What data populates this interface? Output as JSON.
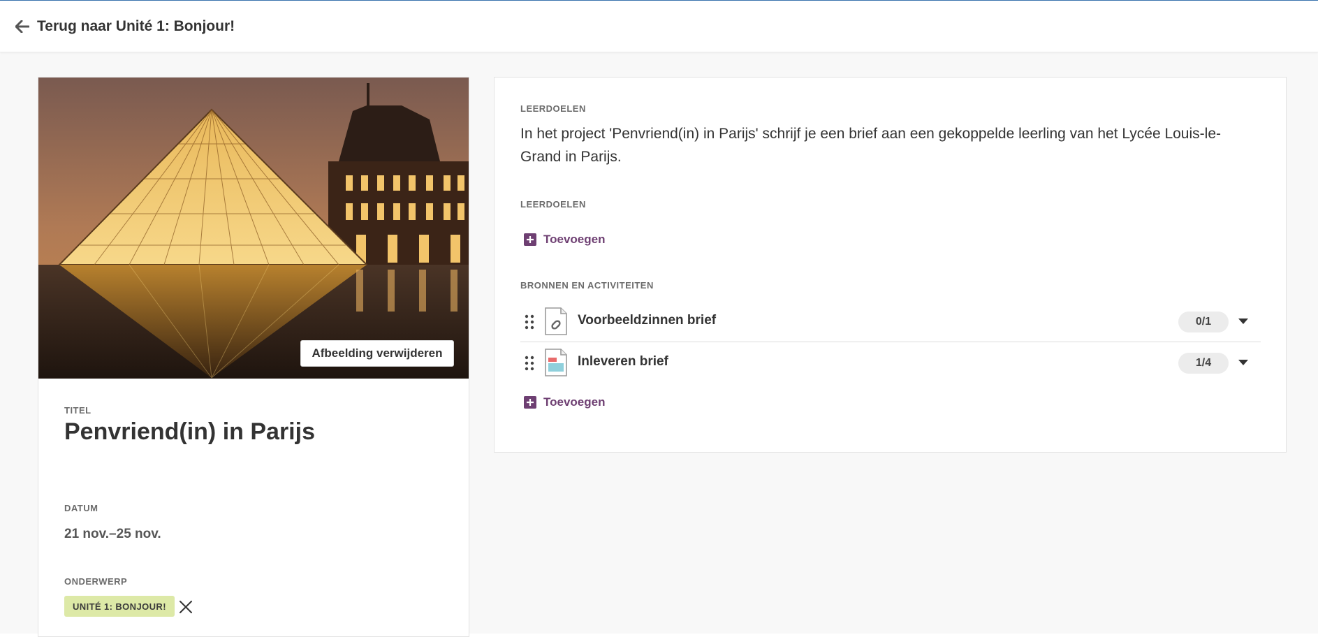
{
  "topbar": {
    "back_label": "Terug naar Unité 1: Bonjour!",
    "back_icon": "arrow-left-icon"
  },
  "image_panel": {
    "remove_label": "Afbeelding verwijderen"
  },
  "details": {
    "title_label": "TITEL",
    "title": "Penvriend(in) in Parijs",
    "date_label": "DATUM",
    "date": "21 nov.–25 nov.",
    "subject_label": "ONDERWERP",
    "subject_tag": "UNITÉ 1: BONJOUR!",
    "tag_color": "#dde9a7"
  },
  "main": {
    "goals_heading": "LEERDOELEN",
    "goals_text": "In het project 'Penvriend(in) in Parijs' schrijf je een brief aan een gekoppelde leerling van het Lycée Louis-le-Grand in Parijs.",
    "goals_heading_2": "LEERDOELEN",
    "add_label_1": "Toevoegen",
    "resources_heading": "BRONNEN EN ACTIVITEITEN",
    "resources": [
      {
        "title": "Voorbeeldzinnen brief",
        "count": "0/1",
        "icon": "link-document-icon"
      },
      {
        "title": "Inleveren brief",
        "count": "1/4",
        "icon": "assignment-document-icon"
      }
    ],
    "add_label_2": "Toevoegen",
    "accent_color": "#6e3f72"
  }
}
